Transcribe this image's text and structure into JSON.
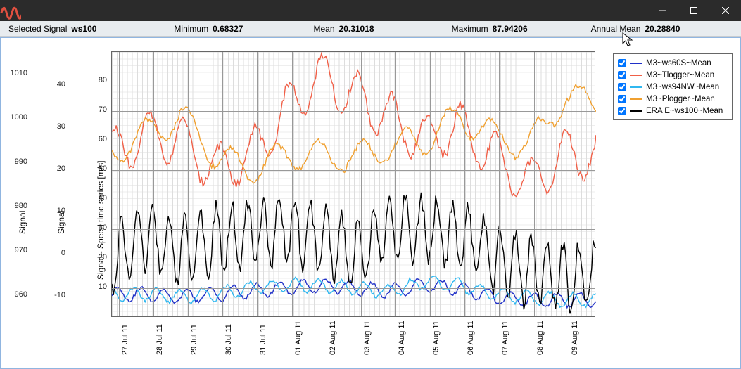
{
  "window": {
    "icon": "app-wave-icon",
    "minimize_title": "Minimize",
    "maximize_title": "Maximize",
    "close_title": "Close"
  },
  "stats": {
    "selected_label": "Selected Signal",
    "selected_value": "ws100",
    "min_label": "Minimum",
    "min_value": "0.68327",
    "mean_label": "Mean",
    "mean_value": "20.31018",
    "max_label": "Maximum",
    "max_value": "87.94206",
    "ann_label": "Annual Mean",
    "ann_value": "20.28840"
  },
  "axes": {
    "y1_label": "Signal",
    "y2_label": "Signal",
    "y3_label": "Signal - Speed time series [m/s]",
    "y1_ticks": [
      "960",
      "970",
      "980",
      "990",
      "1000",
      "1010"
    ],
    "y2_ticks": [
      "-10",
      "0",
      "10",
      "20",
      "30",
      "40"
    ],
    "y3_ticks": [
      "10",
      "20",
      "30",
      "40",
      "50",
      "60",
      "70",
      "80"
    ],
    "x_ticks": [
      "27 Jul 11",
      "28 Jul 11",
      "29 Jul 11",
      "30 Jul 11",
      "31 Jul 11",
      "01 Aug 11",
      "02 Aug 11",
      "03 Aug 11",
      "04 Aug 11",
      "05 Aug 11",
      "06 Aug 11",
      "07 Aug 11",
      "08 Aug 11",
      "09 Aug 11"
    ]
  },
  "legend": {
    "items": [
      {
        "label": "M3~ws60S~Mean",
        "color": "#2030c8",
        "checked": true
      },
      {
        "label": "M3~Tlogger~Mean",
        "color": "#f06048",
        "checked": true
      },
      {
        "label": "M3~ws94NW~Mean",
        "color": "#30b8f0",
        "checked": true
      },
      {
        "label": "M3~Plogger~Mean",
        "color": "#f0a030",
        "checked": true
      },
      {
        "label": "ERA E~ws100~Mean",
        "color": "#000000",
        "checked": true
      }
    ]
  },
  "chart_data": {
    "type": "line",
    "xlabel": "",
    "x_categories": [
      "27 Jul 11",
      "28 Jul 11",
      "29 Jul 11",
      "30 Jul 11",
      "31 Jul 11",
      "01 Aug 11",
      "02 Aug 11",
      "03 Aug 11",
      "04 Aug 11",
      "05 Aug 11",
      "06 Aug 11",
      "07 Aug 11",
      "08 Aug 11",
      "09 Aug 11"
    ],
    "axes": [
      {
        "id": "y1",
        "label": "Signal",
        "range": [
          955,
          1015
        ]
      },
      {
        "id": "y2",
        "label": "Signal",
        "range": [
          -15,
          48
        ]
      },
      {
        "id": "y3",
        "label": "Signal - Speed time series [m/s]",
        "range": [
          0,
          90
        ]
      }
    ],
    "series": [
      {
        "name": "M3~ws60S~Mean",
        "axis": "y3",
        "color": "#2030c8",
        "daily_means_approx": [
          8,
          8,
          7,
          8,
          9,
          10,
          11,
          10,
          9,
          11,
          10,
          7,
          6,
          6
        ]
      },
      {
        "name": "M3~Tlogger~Mean",
        "axis": "y3",
        "color": "#f06048",
        "daily_means_approx": [
          55,
          62,
          60,
          50,
          55,
          70,
          82,
          75,
          68,
          60,
          65,
          55,
          45,
          55
        ]
      },
      {
        "name": "M3~ws94NW~Mean",
        "axis": "y3",
        "color": "#30b8f0",
        "daily_means_approx": [
          8,
          8,
          7,
          8,
          10,
          11,
          11,
          10,
          9,
          12,
          11,
          8,
          7,
          6
        ]
      },
      {
        "name": "M3~Plogger~Mean",
        "axis": "y3",
        "color": "#f0a030",
        "daily_means_approx": [
          56,
          62,
          68,
          55,
          50,
          55,
          55,
          54,
          58,
          60,
          68,
          62,
          58,
          74
        ]
      },
      {
        "name": "ERA E~ws100~Mean",
        "axis": "y3",
        "color": "#000000",
        "daily_means_approx": [
          20,
          28,
          22,
          26,
          28,
          30,
          26,
          22,
          30,
          30,
          28,
          20,
          16,
          14
        ]
      }
    ]
  }
}
